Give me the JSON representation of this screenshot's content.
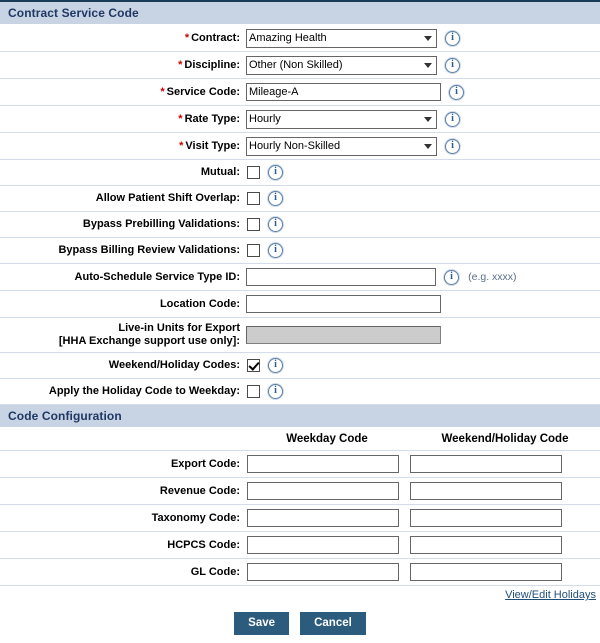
{
  "sections": {
    "contract_service_code": {
      "title": "Contract Service Code",
      "fields": {
        "contract": {
          "label": "Contract:",
          "value": "Amazing Health",
          "required": true
        },
        "discipline": {
          "label": "Discipline:",
          "value": "Other (Non Skilled)",
          "required": true
        },
        "service_code": {
          "label": "Service Code:",
          "value": "Mileage-A",
          "required": true
        },
        "rate_type": {
          "label": "Rate Type:",
          "value": "Hourly",
          "required": true
        },
        "visit_type": {
          "label": "Visit Type:",
          "value": "Hourly Non-Skilled",
          "required": true
        },
        "mutual": {
          "label": "Mutual:",
          "checked": false
        },
        "allow_patient_shift_overlap": {
          "label": "Allow Patient Shift Overlap:",
          "checked": false
        },
        "bypass_prebilling_validations": {
          "label": "Bypass Prebilling Validations:",
          "checked": false
        },
        "bypass_billing_review_validations": {
          "label": "Bypass Billing Review Validations:",
          "checked": false
        },
        "auto_schedule_service_type_id": {
          "label": "Auto-Schedule Service Type ID:",
          "value": "",
          "hint": "(e.g. xxxx)"
        },
        "location_code": {
          "label": "Location Code:",
          "value": ""
        },
        "live_in_units_for_export": {
          "label_line1": "Live-in Units for Export",
          "label_line2": "[HHA Exchange support use only]:",
          "value": "",
          "disabled": true
        },
        "weekend_holiday_codes": {
          "label": "Weekend/Holiday Codes:",
          "checked": true
        },
        "apply_holiday_code_to_weekday": {
          "label": "Apply the Holiday Code to Weekday:",
          "checked": false
        }
      }
    },
    "code_configuration": {
      "title": "Code Configuration",
      "columns": [
        "Weekday Code",
        "Weekend/Holiday Code"
      ],
      "rows": [
        {
          "label": "Export Code:",
          "weekday": "",
          "weekend": ""
        },
        {
          "label": "Revenue Code:",
          "weekday": "",
          "weekend": ""
        },
        {
          "label": "Taxonomy Code:",
          "weekday": "",
          "weekend": ""
        },
        {
          "label": "HCPCS Code:",
          "weekday": "",
          "weekend": ""
        },
        {
          "label": "GL Code:",
          "weekday": "",
          "weekend": ""
        }
      ]
    }
  },
  "footer": {
    "holidays_link": "View/Edit Holidays",
    "save_label": "Save",
    "cancel_label": "Cancel"
  },
  "icons": {
    "info": "i",
    "info_name": "info-icon",
    "chevron": "chevron-down-icon"
  },
  "colors": {
    "section_header_bg": "#c8d3e4",
    "section_header_text": "#1f3864",
    "required_marker": "#cc0000",
    "button_bg": "#2b5c7d",
    "link": "#1f4e79",
    "row_divider": "#d3dceb",
    "disabled_field_bg": "#cccccc",
    "hint_text": "#5a6f86"
  },
  "required_marker": "*"
}
